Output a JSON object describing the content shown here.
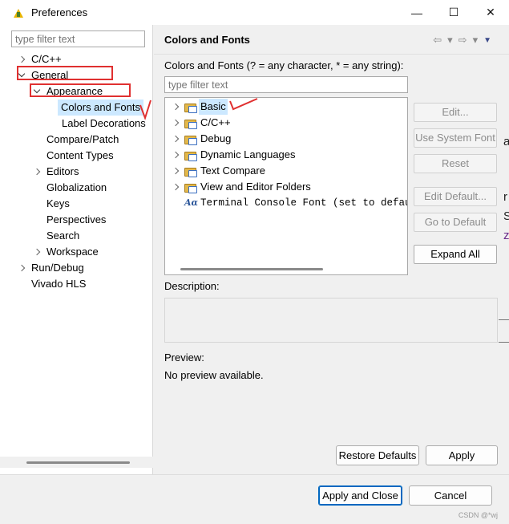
{
  "window": {
    "title": "Preferences",
    "minimize": "—",
    "maximize": "☐",
    "close": "✕"
  },
  "left": {
    "filter_placeholder": "type filter text",
    "tree": [
      {
        "label": "C/C++",
        "expander": "closed",
        "depth": 0
      },
      {
        "label": "General",
        "expander": "open",
        "depth": 0
      },
      {
        "label": "Appearance",
        "expander": "open",
        "depth": 1
      },
      {
        "label": "Colors and Fonts",
        "expander": "none",
        "depth": 2,
        "selected": true
      },
      {
        "label": "Label Decorations",
        "expander": "none",
        "depth": 2
      },
      {
        "label": "Compare/Patch",
        "expander": "none",
        "depth": 1
      },
      {
        "label": "Content Types",
        "expander": "none",
        "depth": 1
      },
      {
        "label": "Editors",
        "expander": "closed",
        "depth": 1
      },
      {
        "label": "Globalization",
        "expander": "none",
        "depth": 1
      },
      {
        "label": "Keys",
        "expander": "none",
        "depth": 1
      },
      {
        "label": "Perspectives",
        "expander": "none",
        "depth": 1
      },
      {
        "label": "Search",
        "expander": "none",
        "depth": 1
      },
      {
        "label": "Workspace",
        "expander": "closed",
        "depth": 1
      },
      {
        "label": "Run/Debug",
        "expander": "closed",
        "depth": 0
      },
      {
        "label": "Vivado HLS",
        "expander": "none",
        "depth": 0
      }
    ]
  },
  "page": {
    "title": "Colors and Fonts",
    "nav_back": "⇦",
    "nav_forward": "⇨",
    "nav_dropdown": "▾",
    "menu": "▼",
    "hint": "Colors and Fonts (? = any character, * = any string):",
    "filter_placeholder": "type filter text",
    "font_tree": [
      {
        "label": "Basic",
        "kind": "folder",
        "selected": true
      },
      {
        "label": "C/C++",
        "kind": "folder"
      },
      {
        "label": "Debug",
        "kind": "folder"
      },
      {
        "label": "Dynamic Languages",
        "kind": "folder"
      },
      {
        "label": "Text Compare",
        "kind": "folder"
      },
      {
        "label": "View and Editor Folders",
        "kind": "folder"
      },
      {
        "label": "Terminal Console Font (set to default",
        "kind": "font",
        "icon": "Aα"
      }
    ],
    "buttons": {
      "edit": "Edit...",
      "use_system_font": "Use System Font",
      "reset": "Reset",
      "edit_default": "Edit Default...",
      "go_to_default": "Go to Default",
      "expand_all": "Expand All"
    },
    "description_label": "Description:",
    "preview_label": "Preview:",
    "preview_text": "No preview available.",
    "restore_defaults": "Restore Defaults",
    "apply": "Apply"
  },
  "footer": {
    "apply_and_close": "Apply and Close",
    "cancel": "Cancel",
    "watermark": "CSDN @*wj"
  },
  "background_edge_text": [
    "a",
    "r",
    "S",
    "z"
  ],
  "colors": {
    "annotation": "#e03030",
    "selection": "#cce8ff",
    "primary_border": "#0067c0"
  }
}
